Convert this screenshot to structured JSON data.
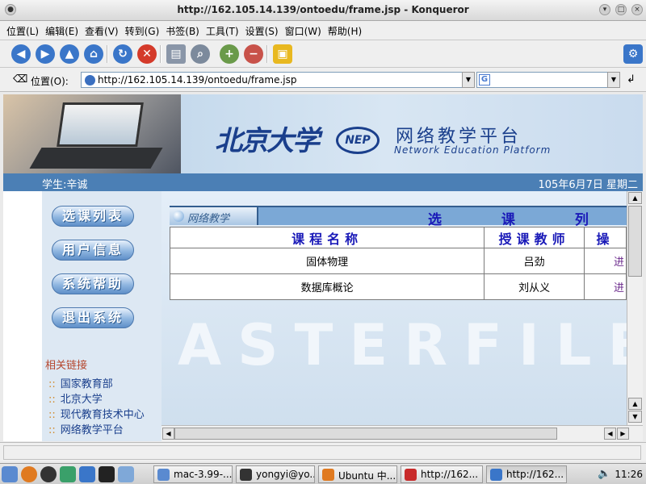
{
  "window": {
    "title": "http://162.105.14.139/ontoedu/frame.jsp - Konqueror"
  },
  "menu": [
    "位置(L)",
    "编辑(E)",
    "查看(V)",
    "转到(G)",
    "书签(B)",
    "工具(T)",
    "设置(S)",
    "窗口(W)",
    "帮助(H)"
  ],
  "toolbar": {
    "icons": [
      "back-icon",
      "forward-icon",
      "up-icon",
      "home-icon",
      "reload-icon",
      "stop-icon",
      "print-icon",
      "search-icon",
      "zoom-in-icon",
      "zoom-out-icon",
      "security-lock-icon",
      "konqueror-gear-icon"
    ]
  },
  "location": {
    "label": "位置(O):",
    "url": "http://162.105.14.139/ontoedu/frame.jsp",
    "search_engine": "G",
    "search_value": ""
  },
  "banner": {
    "university": "北京大学",
    "logo": "NEP",
    "platform_cn": "网络教学平台",
    "platform_en": "Network Education Platform"
  },
  "infobar": {
    "student": "学生:辛诚",
    "date": "105年6月7日 星期二"
  },
  "sidebar": {
    "nav": [
      "选课列表",
      "用户信息",
      "系统帮助",
      "退出系统"
    ],
    "links_title": "相关链接",
    "links": [
      "国家教育部",
      "北京大学",
      "现代教育技术中心",
      "网络教学平台"
    ]
  },
  "content": {
    "watermark": "ASTERFILE",
    "tab_label": "网络教学",
    "table_title": "选 课 列 表",
    "columns": [
      "课程名称",
      "授课教师",
      "操"
    ],
    "rows": [
      {
        "course": "固体物理",
        "teacher": "吕劲",
        "op": "进"
      },
      {
        "course": "数据库概论",
        "teacher": "刘从义",
        "op": "进"
      }
    ]
  },
  "taskbar": {
    "tasks": [
      "mac-3.99-...",
      "yongyi@yo...",
      "Ubuntu 中...",
      "http://162...",
      "http://162..."
    ],
    "clock": "11:26"
  },
  "colors": {
    "accent": "#4b7fb5",
    "title_blue": "#1a1ab8",
    "sidebar_bg": "#dde8f3"
  }
}
